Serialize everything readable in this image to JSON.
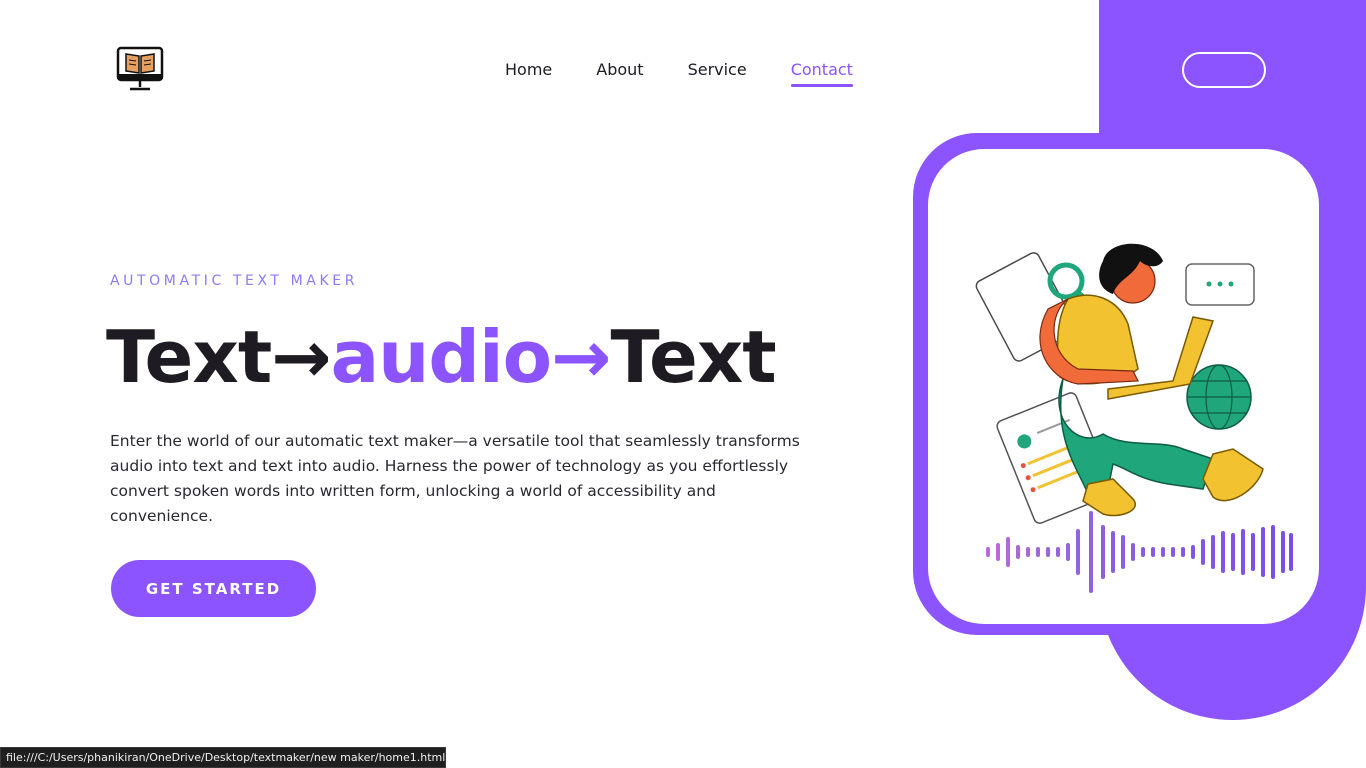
{
  "colors": {
    "accent": "#8b54ff",
    "text": "#1e1c22",
    "eyebrow": "#8b7cf7"
  },
  "header": {
    "logo_icon": "monitor-book-icon",
    "nav": [
      {
        "label": "Home",
        "active": false
      },
      {
        "label": "About",
        "active": false
      },
      {
        "label": "Service",
        "active": false
      },
      {
        "label": "Contact",
        "active": true
      }
    ]
  },
  "hero": {
    "eyebrow": "AUTOMATIC TEXT MAKER",
    "headline": {
      "part1": "Text",
      "arrow1": "→",
      "part2": "audio",
      "arrow2": "→",
      "part3": "Text"
    },
    "description": "Enter the world of our automatic text maker—a versatile tool that seamlessly transforms audio into text and text into audio. Harness the power of technology as you effortlessly convert spoken words into written form, unlocking a world of accessibility and convenience.",
    "cta_label": "GET STARTED"
  },
  "status_bar": {
    "url": "file:///C:/Users/phanikiran/OneDrive/Desktop/textmaker/new maker/home1.html#"
  }
}
